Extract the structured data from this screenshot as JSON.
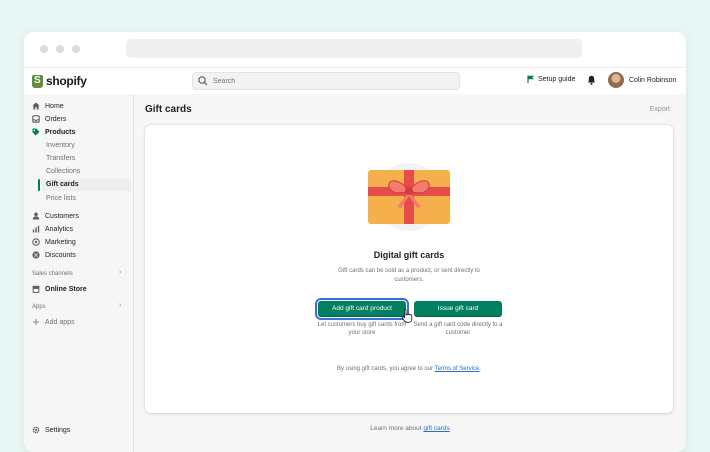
{
  "topbar": {
    "logo_text": "shopify",
    "search_placeholder": "Search",
    "setup_guide": "Setup guide",
    "user_name": "Colin Robinson"
  },
  "sidebar": {
    "home": "Home",
    "orders": "Orders",
    "products": "Products",
    "sub_items": [
      "Inventory",
      "Transfers",
      "Collections",
      "Gift cards",
      "Price lists"
    ],
    "customers": "Customers",
    "analytics": "Analytics",
    "marketing": "Marketing",
    "discounts": "Discounts",
    "sales_channels_label": "Sales channels",
    "online_store": "Online Store",
    "apps_label": "Apps",
    "add_apps": "Add apps",
    "settings": "Settings"
  },
  "main": {
    "title": "Gift cards",
    "export": "Export",
    "card": {
      "heading": "Digital gift cards",
      "description": "Gift cards can be sold as a product, or sent directly to customers.",
      "add_button": "Add gift card product",
      "issue_button": "Issue gift card",
      "add_caption": "Let customers buy gift cards from your store",
      "issue_caption": "Send a gift card code directly to a customer",
      "tos_prefix": "By using gift cards, you agree to our ",
      "tos_link": "Terms of Service",
      "tos_suffix": "."
    },
    "footer_prefix": "Learn more about ",
    "footer_link": "gift cards"
  },
  "colors": {
    "accent": "#008060",
    "focus": "#3b6fd8",
    "link": "#2c6ecb",
    "gift_card": "#f5b04c",
    "ribbon": "#e84b4b"
  }
}
